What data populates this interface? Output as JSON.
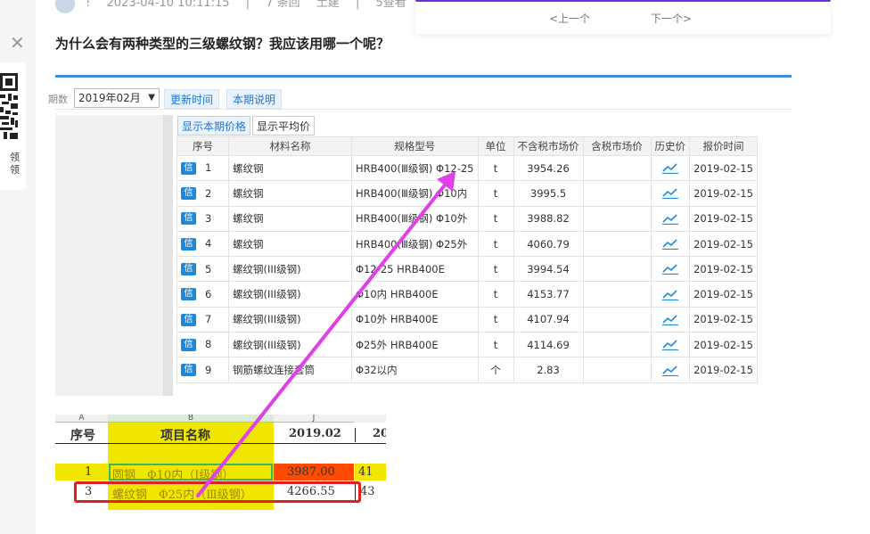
{
  "meta": {
    "author_initial": "!",
    "date": "2023-04-10 10:11:15",
    "answers": "7 条回",
    "tag": "土建",
    "views": "5查看"
  },
  "pager": {
    "prev": "<上一个",
    "next": "下一个>"
  },
  "left": {
    "qr_text": "领\n领"
  },
  "question": {
    "title": "为什么会有两种类型的三级螺纹钢？我应该用哪一个呢？"
  },
  "shot1": {
    "period_label": "期数",
    "period_value": "2019年02月",
    "btn_update": "更新时间",
    "btn_info": "本期说明",
    "tab_current": "显示本期价格",
    "tab_avg": "显示平均价",
    "headers": [
      "序号",
      "材料名称",
      "规格型号",
      "单位",
      "不含税市场价",
      "含税市场价",
      "历史价",
      "报价时间"
    ],
    "badge": "信",
    "rows": [
      {
        "no": "1",
        "name": "螺纹钢",
        "spec": "HRB400(Ⅲ级钢) Φ12-25",
        "unit": "t",
        "price": "3954.26",
        "tax_price": "",
        "date": "2019-02-15"
      },
      {
        "no": "2",
        "name": "螺纹钢",
        "spec": "HRB400(Ⅲ级钢) Φ10内",
        "unit": "t",
        "price": "3995.5",
        "tax_price": "",
        "date": "2019-02-15"
      },
      {
        "no": "3",
        "name": "螺纹钢",
        "spec": "HRB400(Ⅲ级钢) Φ10外",
        "unit": "t",
        "price": "3988.82",
        "tax_price": "",
        "date": "2019-02-15"
      },
      {
        "no": "4",
        "name": "螺纹钢",
        "spec": "HRB400(Ⅲ级钢) Φ25外",
        "unit": "t",
        "price": "4060.79",
        "tax_price": "",
        "date": "2019-02-15"
      },
      {
        "no": "5",
        "name": "螺纹钢(III级钢)",
        "spec": "Φ12-25 HRB400E",
        "unit": "t",
        "price": "3994.54",
        "tax_price": "",
        "date": "2019-02-15"
      },
      {
        "no": "6",
        "name": "螺纹钢(III级钢)",
        "spec": "Φ10内 HRB400E",
        "unit": "t",
        "price": "4153.77",
        "tax_price": "",
        "date": "2019-02-15"
      },
      {
        "no": "7",
        "name": "螺纹钢(III级钢)",
        "spec": "Φ10外 HRB400E",
        "unit": "t",
        "price": "4107.94",
        "tax_price": "",
        "date": "2019-02-15"
      },
      {
        "no": "8",
        "name": "螺纹钢(III级钢)",
        "spec": "Φ25外 HRB400E",
        "unit": "t",
        "price": "4114.69",
        "tax_price": "",
        "date": "2019-02-15"
      },
      {
        "no": "9",
        "name": "钢筋螺纹连接套筒",
        "spec": "Φ32以内",
        "unit": "个",
        "price": "2.83",
        "tax_price": "",
        "date": "2019-02-15"
      }
    ]
  },
  "shot2": {
    "col_a": "A",
    "col_b": "B",
    "col_j": "J",
    "h_no": "序号",
    "h_name": "项目名称",
    "h_date": "2019.02",
    "h_next": "20",
    "r1_no": "1",
    "r1_name": "圆钢　Φ10内（Ⅰ级钢）",
    "r1_val": "3987.00",
    "r1_next": "41",
    "r2_no": "3",
    "r2_name": "螺纹钢　Φ25内（Ⅲ级钢）",
    "r2_val": "4266.55",
    "r2_next": "43",
    "colors": {
      "yellow": "#f0e600",
      "orange_red": "#ff4a00",
      "red_box": "#e02020",
      "arrow": "#e040e8"
    }
  }
}
